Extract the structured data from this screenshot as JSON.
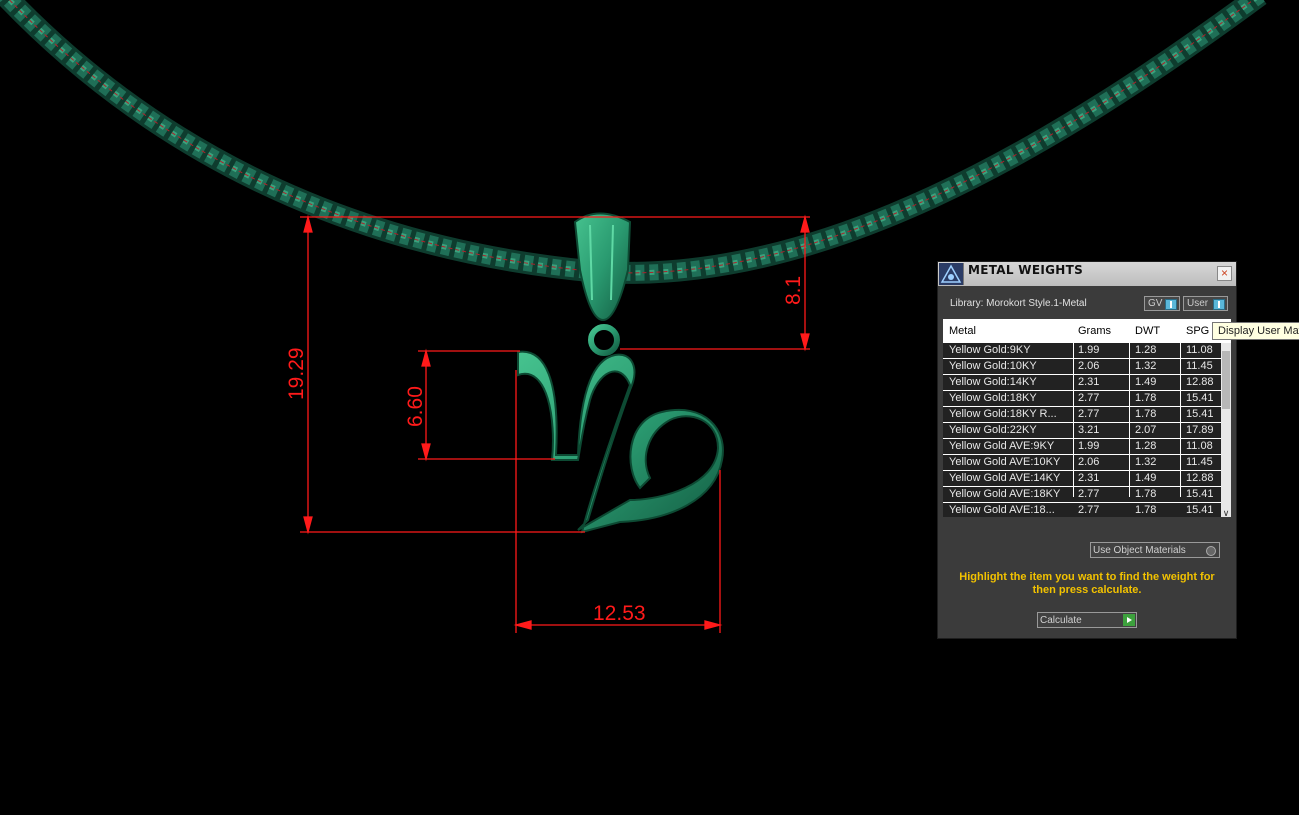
{
  "viewport": {
    "dimensions": {
      "height": "19.29",
      "width": "12.53",
      "symbol_height": "6.60",
      "bail": "8.1"
    }
  },
  "panel": {
    "title": "METAL WEIGHTS",
    "close_icon": "close-icon",
    "library": "Library: Morokort Style.1-Metal",
    "gv_toggle": "GV",
    "user_toggle": "User",
    "columns": [
      "Metal",
      "Grams",
      "DWT",
      "SPG"
    ],
    "rows": [
      {
        "metal": "Yellow Gold:9KY",
        "grams": "1.99",
        "dwt": "1.28",
        "spg": "11.08"
      },
      {
        "metal": "Yellow Gold:10KY",
        "grams": "2.06",
        "dwt": "1.32",
        "spg": "11.45"
      },
      {
        "metal": "Yellow Gold:14KY",
        "grams": "2.31",
        "dwt": "1.49",
        "spg": "12.88"
      },
      {
        "metal": "Yellow Gold:18KY",
        "grams": "2.77",
        "dwt": "1.78",
        "spg": "15.41"
      },
      {
        "metal": "Yellow Gold:18KY R...",
        "grams": "2.77",
        "dwt": "1.78",
        "spg": "15.41"
      },
      {
        "metal": "Yellow Gold:22KY",
        "grams": "3.21",
        "dwt": "2.07",
        "spg": "17.89"
      },
      {
        "metal": "Yellow Gold AVE:9KY",
        "grams": "1.99",
        "dwt": "1.28",
        "spg": "11.08"
      },
      {
        "metal": "Yellow Gold AVE:10KY",
        "grams": "2.06",
        "dwt": "1.32",
        "spg": "11.45"
      },
      {
        "metal": "Yellow Gold AVE:14KY",
        "grams": "2.31",
        "dwt": "1.49",
        "spg": "12.88"
      },
      {
        "metal": "Yellow Gold AVE:18KY",
        "grams": "2.77",
        "dwt": "1.78",
        "spg": "15.41"
      },
      {
        "metal": "Yellow Gold AVE:18...",
        "grams": "2.77",
        "dwt": "1.78",
        "spg": "15.41"
      }
    ],
    "use_object_materials": "Use Object Materials",
    "instructions": "Highlight the item you want to find the weight for then press calculate.",
    "calculate": "Calculate"
  },
  "tooltip": "Display User Materials",
  "colors": {
    "chain": "#1f6f57",
    "pendant": "#2c9a73",
    "dimension": "#ff1a1a",
    "instructions": "#f2c200"
  }
}
